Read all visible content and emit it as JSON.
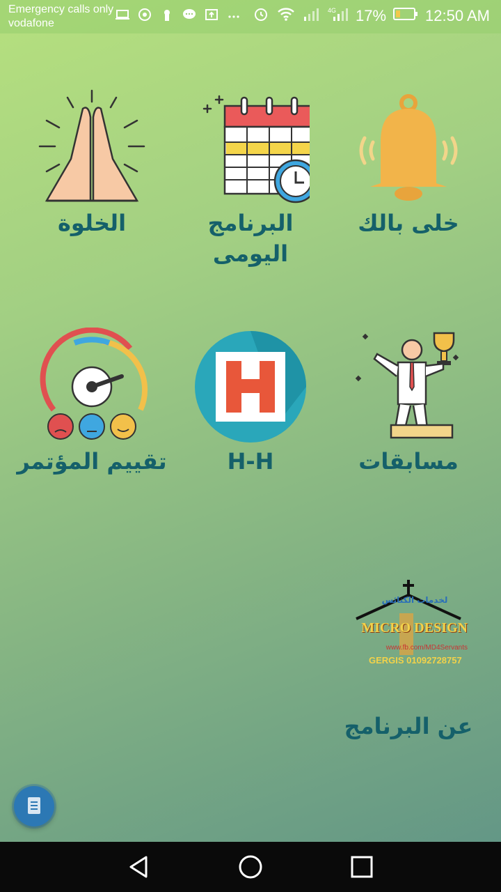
{
  "status": {
    "line1": "Emergency calls only",
    "line2": "vodafone",
    "battery": "17%",
    "time": "12:50 AM"
  },
  "tiles": [
    {
      "label": "الخلوة",
      "icon": "praying-hands-icon"
    },
    {
      "label": "البرنامج اليومى",
      "icon": "calendar-clock-icon"
    },
    {
      "label": "خلى بالك",
      "icon": "bell-icon"
    },
    {
      "label": "تقييم المؤتمر",
      "icon": "rating-gauge-icon"
    },
    {
      "label": "H-H",
      "icon": "hh-logo-icon"
    },
    {
      "label": "مسابقات",
      "icon": "winner-trophy-icon"
    },
    {
      "label": "عن البرنامج",
      "icon": "micro-design-logo"
    }
  ],
  "logo": {
    "top_text": "لخدمات الكنائس",
    "brand": "MICRO DESIGN",
    "url": "www.fb.com/MD4Servants",
    "contact": "GERGIS 01092728757"
  },
  "fab": {
    "icon": "document-icon"
  },
  "navbar": {
    "back": "back-icon",
    "home": "home-icon",
    "recents": "recents-icon"
  }
}
